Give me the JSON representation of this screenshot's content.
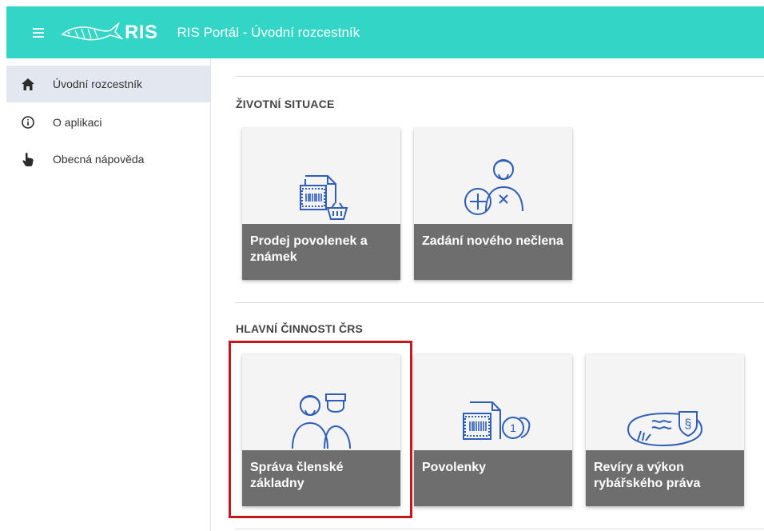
{
  "header": {
    "logo_text": "RIS",
    "title": "RIS Portál - Úvodní rozcestník",
    "menu_icon": "hamburger-icon"
  },
  "sidebar": {
    "items": [
      {
        "label": "Úvodní rozcestník",
        "icon": "home-icon",
        "active": true
      },
      {
        "label": "O aplikaci",
        "icon": "info-icon",
        "active": false
      },
      {
        "label": "Obecná nápověda",
        "icon": "help-hand-icon",
        "active": false
      }
    ]
  },
  "sections": [
    {
      "title": "ŽIVOTNÍ SITUACE",
      "tiles": [
        {
          "label": "Prodej povolenek a známek",
          "icon": "permit-basket-icon"
        },
        {
          "label": "Zadání nového nečlena",
          "icon": "new-nonmember-icon"
        }
      ]
    },
    {
      "title": "HLAVNÍ ČINNOSTI ČRS",
      "tiles": [
        {
          "label": "Správa členské základny",
          "icon": "members-icon",
          "highlighted": true
        },
        {
          "label": "Povolenky",
          "icon": "permit-coins-icon"
        },
        {
          "label": "Revíry a výkon rybářského práva",
          "icon": "fishing-ground-icon"
        }
      ]
    }
  ],
  "colors": {
    "header_bg": "#33d6c6",
    "icon_blue": "#2f5db7",
    "tile_label_bg": "#6e6e6e",
    "highlight": "#c0181c",
    "active_nav_bg": "#e3e8f0"
  }
}
